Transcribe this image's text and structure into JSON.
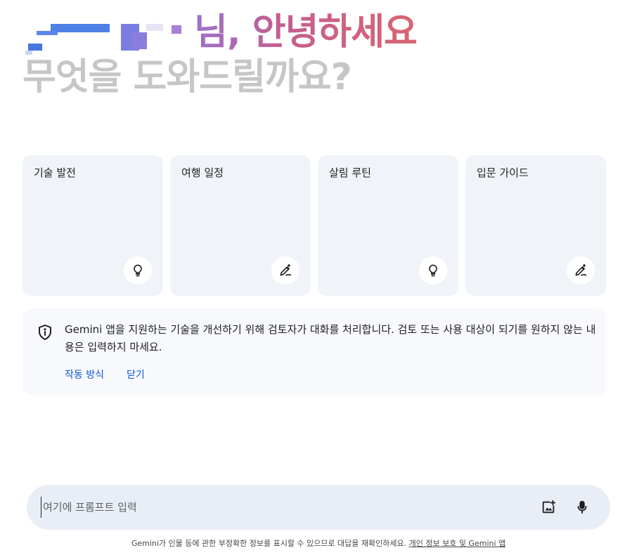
{
  "greeting": {
    "line1_suffix": "님, 안녕하세요",
    "line2": "무엇을 도와드릴까요?"
  },
  "cards": [
    {
      "title": "기술 발전",
      "icon": "lightbulb-icon"
    },
    {
      "title": "여행 일정",
      "icon": "pen-sparkle-icon"
    },
    {
      "title": "살림 루틴",
      "icon": "lightbulb-icon"
    },
    {
      "title": "입문 가이드",
      "icon": "pen-sparkle-icon"
    }
  ],
  "notice": {
    "text": "Gemini 앱을 지원하는 기술을 개선하기 위해 검토자가 대화를 처리합니다. 검토 또는 사용 대상이 되기를 원하지 않는 내용은 입력하지 마세요.",
    "link_how": "작동 방식",
    "link_close": "닫기"
  },
  "prompt": {
    "placeholder": "여기에 프롬프트 입력"
  },
  "footer": {
    "text": "Gemini가 인물 등에 관한 부정확한 정보를 표시할 수 있으므로 대답을 재확인하세요.",
    "link": "개인 정보 보호 및 Gemini 앱"
  },
  "colors": {
    "card_bg": "#f0f4f9",
    "prompt_bg": "#e9eef6",
    "link": "#0b57d0",
    "greeting_gradient_start": "#9b72cb",
    "greeting_gradient_end": "#d96570",
    "subtitle": "#c4c7c5"
  }
}
